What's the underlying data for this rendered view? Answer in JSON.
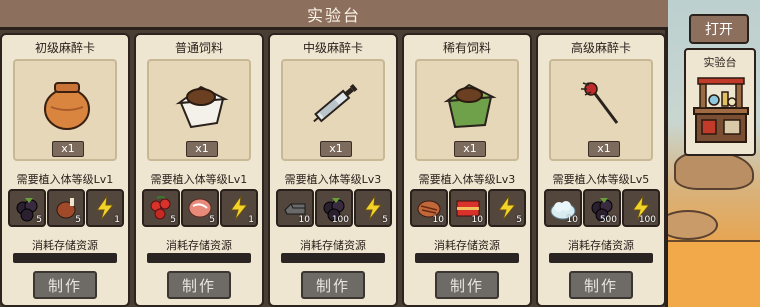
{
  "title": "实验台",
  "open_label": "打开",
  "side_label": "实验台",
  "require_prefix": "需要植入体等级",
  "consume_label": "消耗存储资源",
  "make_label": "制作",
  "colors": {
    "panel": "#4a3d34",
    "title": "#8d6f5e",
    "card": "#efe6d1"
  },
  "cards": [
    {
      "name": "初级麻醉卡",
      "icon": "clay-pot-icon",
      "qty": "x1",
      "level": "Lv1",
      "resources": [
        {
          "icon": "berry-icon",
          "count": "5"
        },
        {
          "icon": "meat-leg-icon",
          "count": "5"
        },
        {
          "icon": "energy-icon",
          "count": "1"
        }
      ]
    },
    {
      "name": "普通饲料",
      "icon": "feed-bag-white-icon",
      "qty": "x1",
      "level": "Lv1",
      "resources": [
        {
          "icon": "red-berry-icon",
          "count": "5"
        },
        {
          "icon": "raw-meat-icon",
          "count": "5"
        },
        {
          "icon": "energy-icon",
          "count": "1"
        }
      ]
    },
    {
      "name": "中级麻醉卡",
      "icon": "syringe-icon",
      "qty": "x1",
      "level": "Lv3",
      "resources": [
        {
          "icon": "metal-ingot-icon",
          "count": "10"
        },
        {
          "icon": "berry-icon",
          "count": "100"
        },
        {
          "icon": "energy-icon",
          "count": "5"
        }
      ]
    },
    {
      "name": "稀有饲料",
      "icon": "feed-bag-green-icon",
      "qty": "x1",
      "level": "Lv3",
      "resources": [
        {
          "icon": "steak-icon",
          "count": "10"
        },
        {
          "icon": "cake-icon",
          "count": "10"
        },
        {
          "icon": "energy-icon",
          "count": "5"
        }
      ]
    },
    {
      "name": "高级麻醉卡",
      "icon": "dart-icon",
      "qty": "x1",
      "level": "Lv5",
      "resources": [
        {
          "icon": "snow-pile-icon",
          "count": "10"
        },
        {
          "icon": "berry-icon",
          "count": "500"
        },
        {
          "icon": "energy-icon",
          "count": "100"
        }
      ]
    }
  ]
}
